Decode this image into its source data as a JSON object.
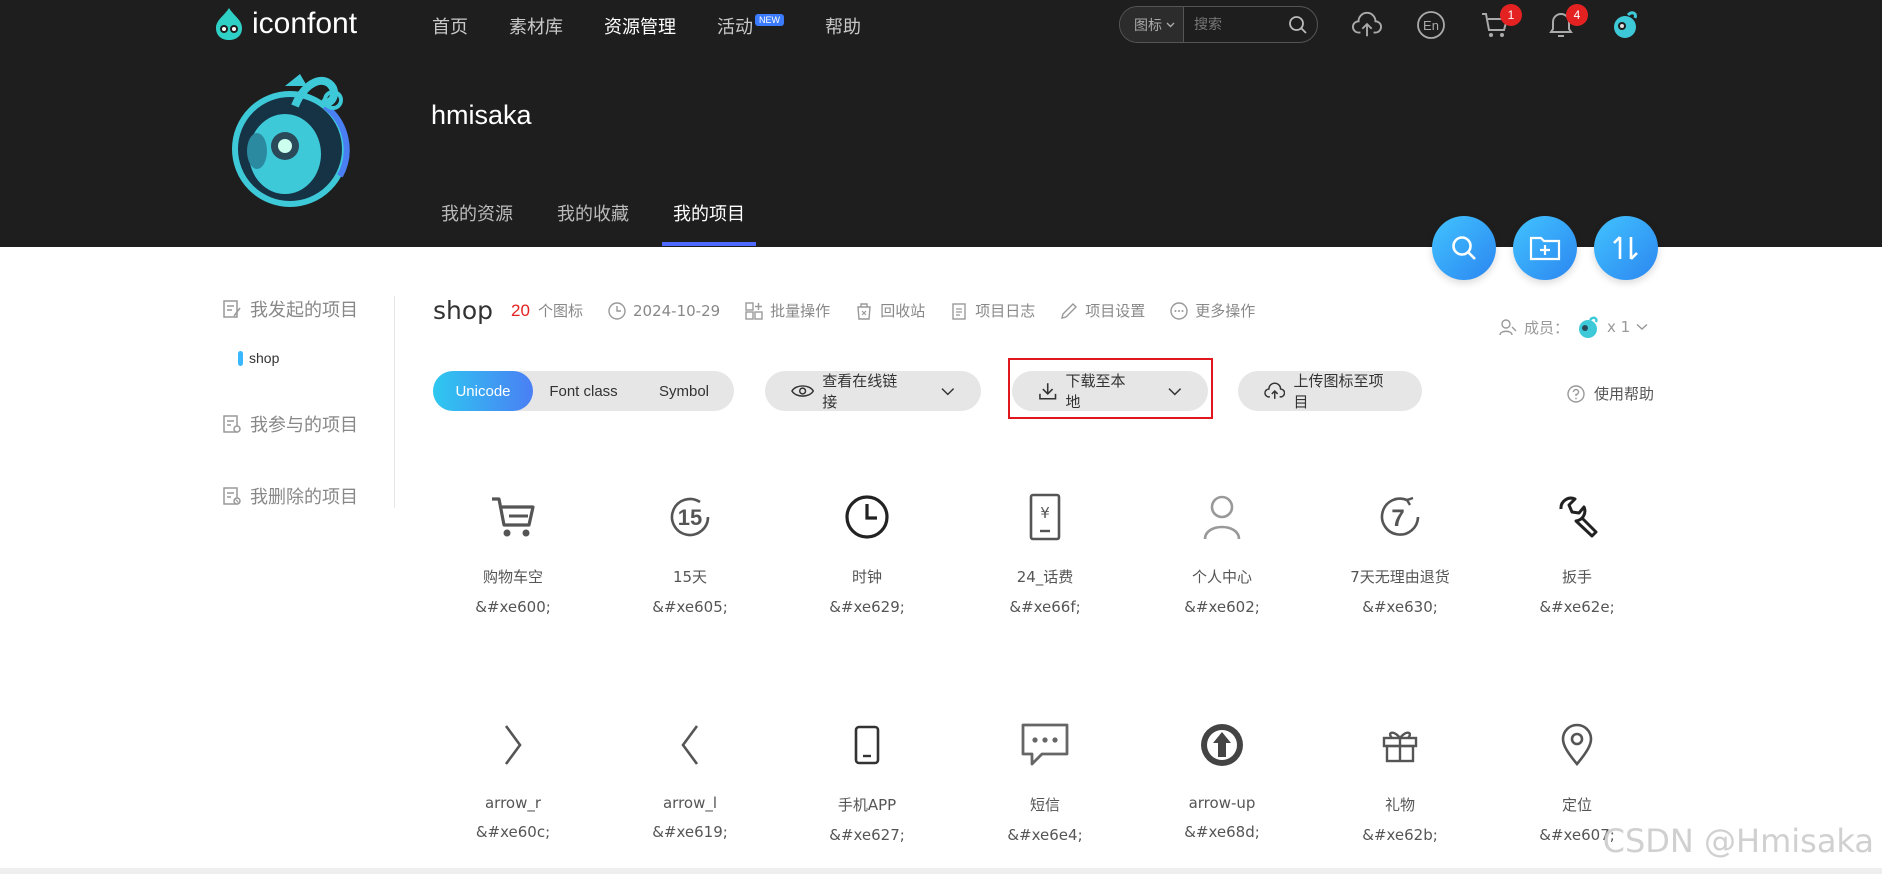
{
  "brand": {
    "name": "iconfont"
  },
  "nav": [
    {
      "label": "首页"
    },
    {
      "label": "素材库"
    },
    {
      "label": "资源管理",
      "active": true
    },
    {
      "label": "活动",
      "badge": "NEW"
    },
    {
      "label": "帮助"
    }
  ],
  "search": {
    "type": "图标",
    "placeholder": "搜索"
  },
  "header_icons": {
    "cart_count": "1",
    "bell_count": "4",
    "lang": "En"
  },
  "profile": {
    "username": "hmisaka"
  },
  "subtabs": [
    {
      "label": "我的资源"
    },
    {
      "label": "我的收藏"
    },
    {
      "label": "我的项目",
      "active": true
    }
  ],
  "sidebar": {
    "created": "我发起的项目",
    "current_project": "shop",
    "joined": "我参与的项目",
    "deleted": "我删除的项目"
  },
  "project": {
    "name": "shop",
    "icon_count": "20",
    "icon_count_label": "个图标",
    "date": "2024-10-29",
    "actions": [
      "批量操作",
      "回收站",
      "项目日志",
      "项目设置",
      "更多操作"
    ],
    "members_label": "成员：",
    "members_count": "x 1"
  },
  "toolbar": {
    "formats": [
      "Unicode",
      "Font class",
      "Symbol"
    ],
    "active_format": "Unicode",
    "view_link": "查看在线链接",
    "download": "下载至本地",
    "upload": "上传图标至项目",
    "help": "使用帮助"
  },
  "icons": [
    {
      "label": "购物车空",
      "code": "&#xe600;",
      "icon": "cart-icon"
    },
    {
      "label": "15天",
      "code": "&#xe605;",
      "icon": "fifteen-days-icon"
    },
    {
      "label": "时钟",
      "code": "&#xe629;",
      "icon": "clock-icon"
    },
    {
      "label": "24_话费",
      "code": "&#xe66f;",
      "icon": "phone-bill-icon"
    },
    {
      "label": "个人中心",
      "code": "&#xe602;",
      "icon": "user-icon"
    },
    {
      "label": "7天无理由退货",
      "code": "&#xe630;",
      "icon": "seven-days-return-icon"
    },
    {
      "label": "扳手",
      "code": "&#xe62e;",
      "icon": "wrench-icon"
    },
    {
      "label": "arrow_r",
      "code": "&#xe60c;",
      "icon": "arrow-right-icon"
    },
    {
      "label": "arrow_l",
      "code": "&#xe619;",
      "icon": "arrow-left-icon"
    },
    {
      "label": "手机APP",
      "code": "&#xe627;",
      "icon": "mobile-icon"
    },
    {
      "label": "短信",
      "code": "&#xe6e4;",
      "icon": "sms-icon"
    },
    {
      "label": "arrow-up",
      "code": "&#xe68d;",
      "icon": "arrow-up-circle-icon"
    },
    {
      "label": "礼物",
      "code": "&#xe62b;",
      "icon": "gift-icon"
    },
    {
      "label": "定位",
      "code": "&#xe607;",
      "icon": "location-icon"
    }
  ],
  "watermark": "CSDN @Hmisaka",
  "colors": {
    "header_bg": "#1e1e1e",
    "accent": "#4f6bff",
    "badge": "#e52222",
    "highlight_box": "#e0171f"
  }
}
